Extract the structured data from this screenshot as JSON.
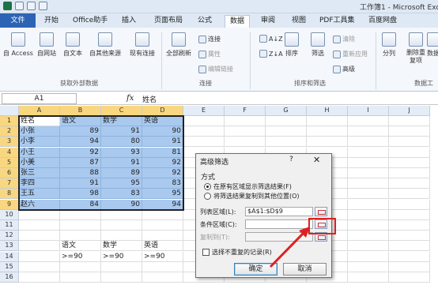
{
  "window": {
    "title": "工作簿1 - Microsoft Exce"
  },
  "tabs": [
    "文件",
    "开始",
    "Office助手",
    "插入",
    "页面布局",
    "公式",
    "数据",
    "审阅",
    "视图",
    "PDF工具集",
    "百度网盘"
  ],
  "ribbon": {
    "external": {
      "buttons": [
        "自 Access",
        "自网站",
        "自文本",
        "自其他来源",
        "现有连接"
      ],
      "group_label": "获取外部数据"
    },
    "connections": {
      "refresh": "全部刷新",
      "items": [
        "连接",
        "属性",
        "编辑链接"
      ],
      "group_label": "连接"
    },
    "sort_filter": {
      "sort_az": "A↓Z",
      "sort_za": "Z↓A",
      "sort": "排序",
      "filter": "筛选",
      "items": [
        "清除",
        "重新应用",
        "高级"
      ],
      "group_label": "排序和筛选"
    },
    "data_tools": {
      "buttons": [
        "分列",
        "删除重复项",
        "数据有效性"
      ],
      "group_label": "数据工"
    }
  },
  "formula_bar": {
    "name_box": "A1",
    "fx": "fx",
    "value": "姓名"
  },
  "sheet": {
    "columns": [
      "A",
      "B",
      "C",
      "D",
      "E",
      "F",
      "G",
      "H",
      "I",
      "J"
    ],
    "rows": [
      "1",
      "2",
      "3",
      "4",
      "5",
      "6",
      "7",
      "8",
      "9",
      "10",
      "11",
      "12",
      "13",
      "14",
      "15",
      "16"
    ],
    "header": [
      "姓名",
      "语文",
      "数学",
      "英语"
    ],
    "data": [
      [
        "小张",
        "89",
        "91",
        "90"
      ],
      [
        "小李",
        "94",
        "80",
        "91"
      ],
      [
        "小王",
        "92",
        "93",
        "81"
      ],
      [
        "小美",
        "87",
        "91",
        "92"
      ],
      [
        "张三",
        "88",
        "89",
        "92"
      ],
      [
        "李四",
        "91",
        "95",
        "83"
      ],
      [
        "王五",
        "98",
        "83",
        "95"
      ],
      [
        "赵六",
        "84",
        "90",
        "94"
      ]
    ],
    "criteria": {
      "header": [
        "语文",
        "数学",
        "英语"
      ],
      "values": [
        ">=90",
        ">=90",
        ">=90"
      ]
    }
  },
  "dialog": {
    "title": "高级筛选",
    "help": "?",
    "close": "✕",
    "section": "方式",
    "option_inplace": "在原有区域显示筛选结果(F)",
    "option_copy": "将筛选结果复制到其他位置(O)",
    "list_range_label": "列表区域(L):",
    "list_range_value": "$A$1:$D$9",
    "criteria_range_label": "条件区域(C):",
    "criteria_range_value": "",
    "copy_to_label": "复制到(T):",
    "copy_to_value": "",
    "unique_label": "选择不重复的记录(R)",
    "ok": "确定",
    "cancel": "取消"
  },
  "colors": {
    "selection": "#a9c9ee",
    "accent": "#2c63b5",
    "annotation": "#e02020"
  }
}
